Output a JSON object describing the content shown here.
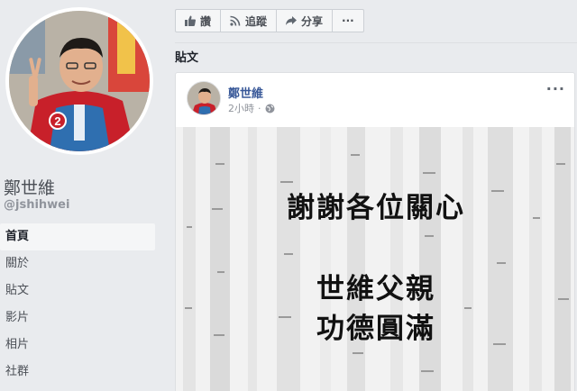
{
  "sidebar": {
    "page_name": "鄭世維",
    "handle": "@jshihwei",
    "nav_items": [
      {
        "label": "首頁",
        "active": true
      },
      {
        "label": "關於",
        "active": false
      },
      {
        "label": "貼文",
        "active": false
      },
      {
        "label": "影片",
        "active": false
      },
      {
        "label": "相片",
        "active": false
      },
      {
        "label": "社群",
        "active": false
      }
    ],
    "avatar_badge": "2"
  },
  "actions": {
    "like_label": "讚",
    "follow_label": "追蹤",
    "share_label": "分享",
    "more_label": "···"
  },
  "section_title": "貼文",
  "post": {
    "author": "鄭世維",
    "time": "2小時",
    "separator": "·",
    "menu": "···",
    "image_lines": [
      "謝謝各位關心",
      "世維父親",
      "功德圓滿"
    ]
  },
  "colors": {
    "link": "#385898",
    "background": "#e9ebee",
    "jacket_red": "#c8202a",
    "vest_blue": "#2f6fb0"
  }
}
